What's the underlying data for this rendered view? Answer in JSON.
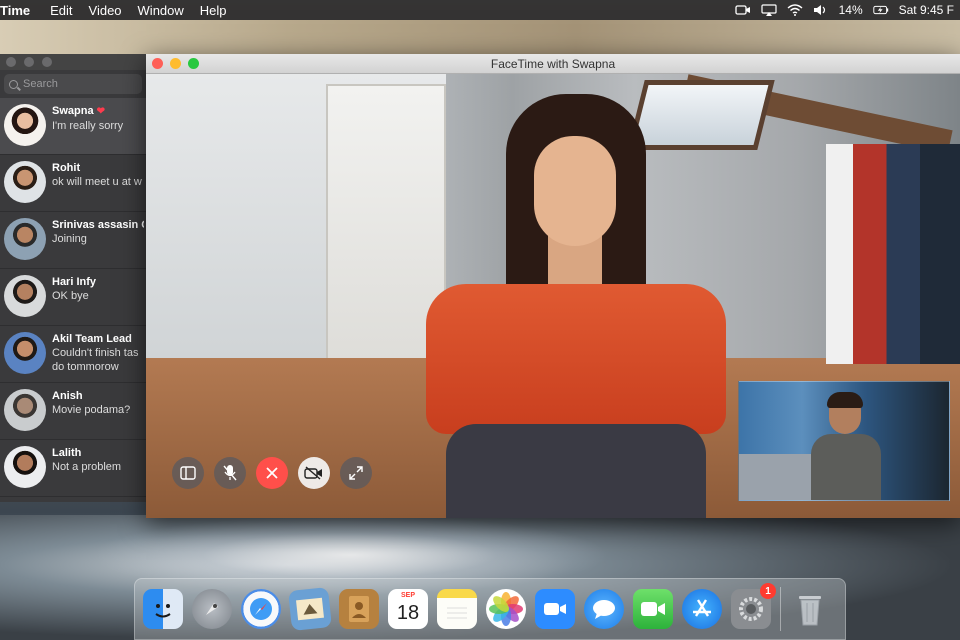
{
  "menubar": {
    "app_name": "Time",
    "menus": [
      "Edit",
      "Video",
      "Window",
      "Help"
    ],
    "battery": "14%",
    "clock": "Sat 9:45 F"
  },
  "messages_sidebar": {
    "search_placeholder": "Search",
    "conversations": [
      {
        "name": "Swapna",
        "message": "I'm really sorry",
        "heart": "❤",
        "active": true
      },
      {
        "name": "Rohit",
        "message": "ok will meet u at w"
      },
      {
        "name": "Srinivas assasin C",
        "message": "Joining"
      },
      {
        "name": "Hari Infy",
        "message": "OK bye"
      },
      {
        "name": "Akil Team Lead",
        "message": "Couldn't finish tas",
        "message2": "do tommorow"
      },
      {
        "name": "Anish",
        "message": "Movie podama?"
      },
      {
        "name": "Lalith",
        "message": "Not a problem"
      }
    ]
  },
  "facetime": {
    "window_title": "FaceTime with Swapna",
    "controls": [
      "sidebar-toggle",
      "mute-microphone",
      "end-call",
      "camera-off",
      "fullscreen"
    ]
  },
  "dock": {
    "calendar_month": "SEP",
    "calendar_day": "18",
    "system_prefs_badge": "1",
    "apps": [
      "finder",
      "launchpad",
      "safari",
      "mail",
      "contacts",
      "calendar",
      "notes",
      "photos",
      "zoom",
      "messages",
      "facetime",
      "app-store",
      "system-preferences",
      "trash"
    ]
  },
  "colors": {
    "end_call": "#ff4f4a",
    "close": "#fe5f57",
    "minimize": "#febc2e",
    "maximize": "#28c840",
    "badge": "#ff3b30"
  }
}
